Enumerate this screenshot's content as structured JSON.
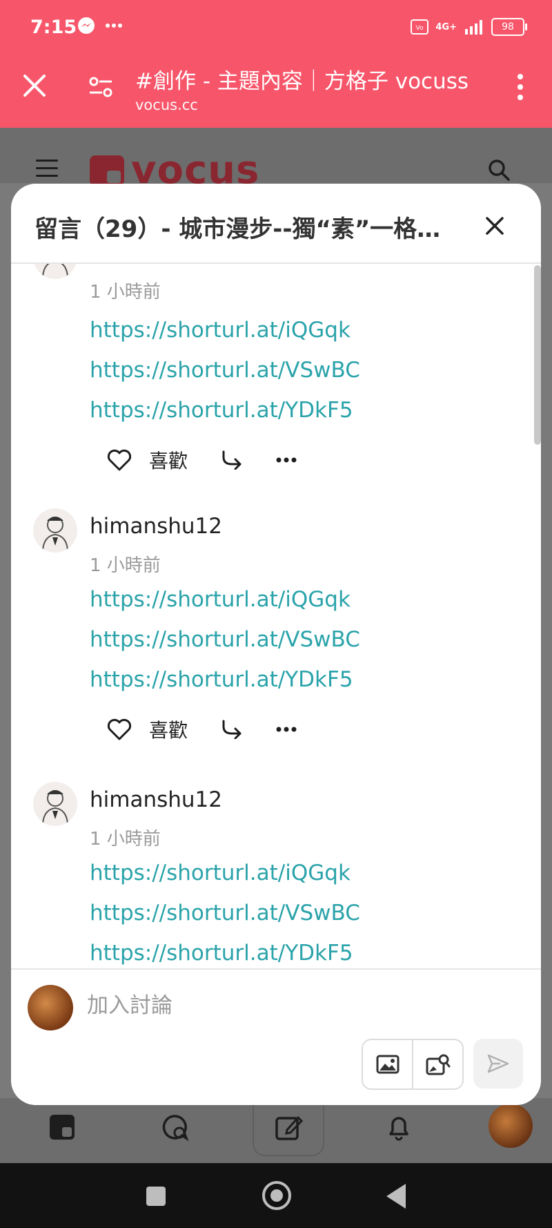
{
  "status_bar": {
    "time": "7:15",
    "network": "4G+",
    "battery": "98"
  },
  "browser": {
    "page_title": "#創作 - 主題內容｜方格子 vocuss",
    "url": "vocus.cc"
  },
  "site": {
    "logo_text": "vocus"
  },
  "modal": {
    "title": "留言（29）- 城市漫步--獨“素”一格…"
  },
  "comments": [
    {
      "username": "",
      "time": "1 小時前",
      "links": [
        "https://shorturl.at/iQGqk",
        "https://shorturl.at/VSwBC",
        "https://shorturl.at/YDkF5"
      ],
      "like_label": "喜歡"
    },
    {
      "username": "himanshu12",
      "time": "1 小時前",
      "links": [
        "https://shorturl.at/iQGqk",
        "https://shorturl.at/VSwBC",
        "https://shorturl.at/YDkF5"
      ],
      "like_label": "喜歡"
    },
    {
      "username": "himanshu12",
      "time": "1 小時前",
      "links": [
        "https://shorturl.at/iQGqk",
        "https://shorturl.at/VSwBC",
        "https://shorturl.at/YDkF5"
      ]
    }
  ],
  "compose": {
    "placeholder": "加入討論"
  },
  "colors": {
    "header_red": "#f7566a",
    "link_teal": "#2aa3aa",
    "brand": "#8a2630"
  }
}
